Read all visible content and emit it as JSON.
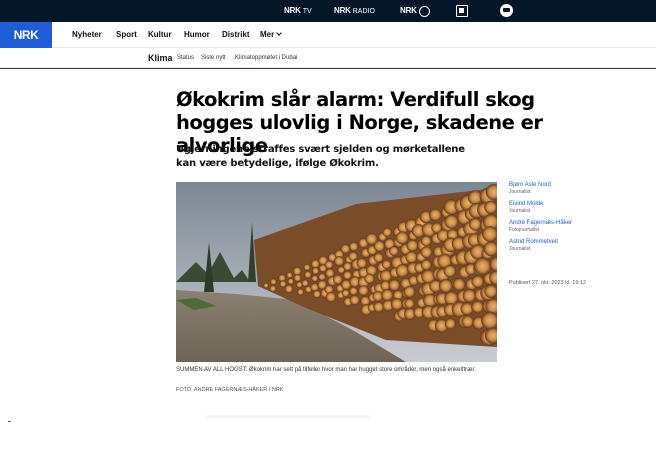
{
  "servicebar": {
    "items": [
      {
        "brand": "NRK",
        "label": "TV"
      },
      {
        "brand": "NRK",
        "label": "RADIO"
      },
      {
        "brand": "NRK",
        "label": ""
      }
    ]
  },
  "nav": {
    "logo": "NRK",
    "items": [
      "Nyheter",
      "Sport",
      "Kultur",
      "Humor",
      "Distrikt",
      "Mer"
    ]
  },
  "subnav": {
    "section": "Klima",
    "links": [
      "Status",
      "Siste nytt",
      "Klimatoppmøtet i Dubai"
    ]
  },
  "article": {
    "headline": "Økokrim slår alarm: Verdifull skog hogges ulovlig i Norge, skadene er alvorlige",
    "lede": "Ugjerningene straffes svært sjelden og mørketallene kan være betydelige, ifølge Økokrim.",
    "caption": "SUMMEN AV ALL HOGST: Økokrim har sett på tilfeller hvor man har hugget store områder, men også enkelttrær.",
    "credit": "FOTO: ANDRÉ FAGERNÆS-HÅKER / NRK",
    "published": "Publisert 27. okt. 2023 kl. 19:12",
    "authors": [
      {
        "name": "Bjørn Asle Nord",
        "role": "Journalist"
      },
      {
        "name": "Eivind Molde",
        "role": "Journalist"
      },
      {
        "name": "André Fagernæs-Håker",
        "role": "Fotojournalist"
      },
      {
        "name": "Astrid Rommetveit",
        "role": "Journalist"
      }
    ]
  },
  "colors": {
    "nrk_blue": "#1e5cd8",
    "servicebar": "#061629",
    "link": "#1e5cd8"
  }
}
